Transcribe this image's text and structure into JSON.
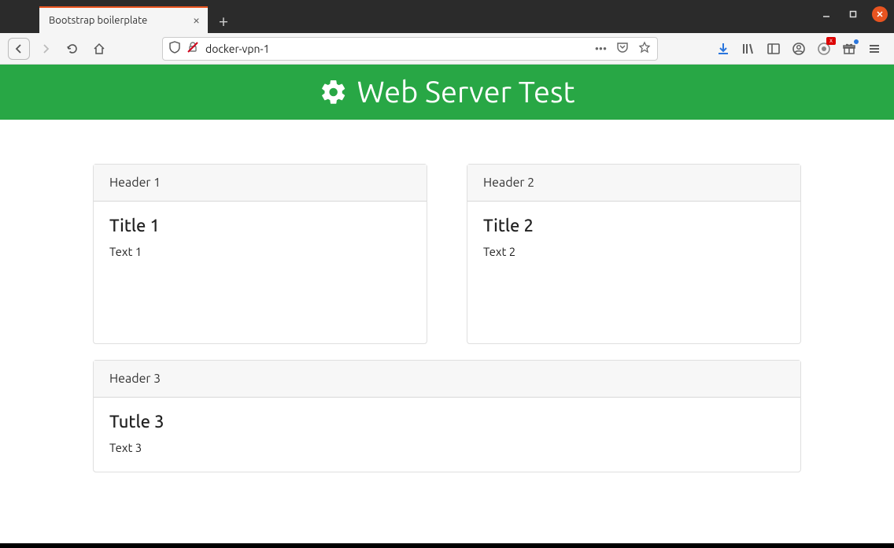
{
  "browser": {
    "tab_title": "Bootstrap boilerplate",
    "url": "docker-vpn-1"
  },
  "page": {
    "header_title": "Web Server Test"
  },
  "cards": [
    {
      "header": "Header 1",
      "title": "Title 1",
      "text": "Text 1"
    },
    {
      "header": "Header 2",
      "title": "Title 2",
      "text": "Text 2"
    },
    {
      "header": "Header 3",
      "title": "Tutle 3",
      "text": "Text 3"
    }
  ]
}
